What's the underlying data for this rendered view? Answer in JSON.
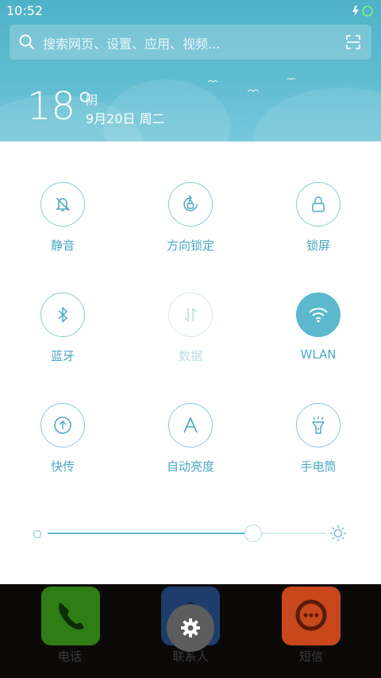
{
  "status_bar": {
    "time": "10:52",
    "icons": [
      "charging-bolt-icon",
      "battery-icon"
    ]
  },
  "search": {
    "placeholder": "搜索网页、设置、应用、视频...",
    "icon": "search-icon",
    "action_icon": "scan-icon"
  },
  "weather": {
    "temperature": "18°",
    "condition": "阴",
    "date": "9月20日 周二"
  },
  "quick_settings": {
    "tiles": [
      {
        "label": "静音",
        "icon": "mute-bell-icon",
        "state": "off"
      },
      {
        "label": "方向锁定",
        "icon": "rotation-lock-icon",
        "state": "off"
      },
      {
        "label": "锁屏",
        "icon": "lock-icon",
        "state": "off"
      },
      {
        "label": "蓝牙",
        "icon": "bluetooth-icon",
        "state": "off"
      },
      {
        "label": "数据",
        "icon": "data-transfer-icon",
        "state": "disabled"
      },
      {
        "label": "WLAN",
        "icon": "wifi-icon",
        "state": "on"
      },
      {
        "label": "快传",
        "icon": "upload-icon",
        "state": "off"
      },
      {
        "label": "自动亮度",
        "icon": "auto-brightness-icon",
        "state": "off"
      },
      {
        "label": "手电筒",
        "icon": "flashlight-icon",
        "state": "off"
      }
    ],
    "brightness": {
      "level": 0.74
    }
  },
  "dock": {
    "apps": [
      {
        "label": "电话",
        "icon": "phone-icon",
        "color": "#2f7d14"
      },
      {
        "label": "联系人",
        "icon": "contacts-icon",
        "color": "#1f3d6b"
      },
      {
        "label": "短信",
        "icon": "message-icon",
        "color": "#c8471c"
      }
    ],
    "settings_icon": "gear-icon"
  },
  "colors": {
    "accent": "#5bb8cf",
    "header": "#5fbcd0"
  }
}
